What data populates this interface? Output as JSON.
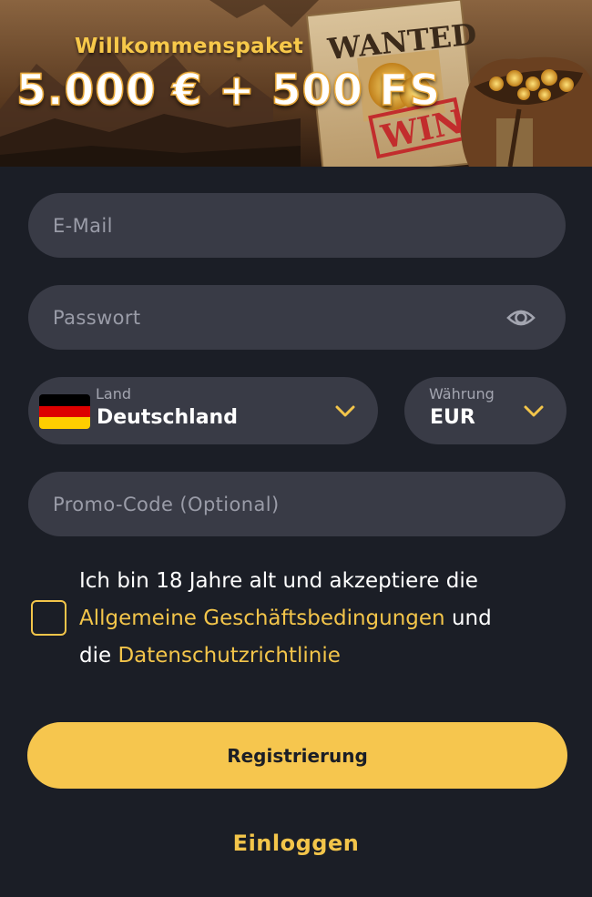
{
  "banner": {
    "subtitle": "Willkommenspaket",
    "title": "5.000 € + 500 FS",
    "poster_text": "WANTED",
    "stamp_text": "WIN"
  },
  "form": {
    "email_placeholder": "E-Mail",
    "password_placeholder": "Passwort",
    "country": {
      "label": "Land",
      "value": "Deutschland",
      "flag": "de-flag"
    },
    "currency": {
      "label": "Währung",
      "value": "EUR"
    },
    "promo_placeholder": "Promo-Code (Optional)",
    "consent": {
      "checked": false,
      "text_before": "Ich bin 18 Jahre alt und akzeptiere die",
      "terms_link": "Allgemeine Geschäftsbedingungen",
      "text_and": "und",
      "text_die": "die",
      "privacy_link": "Datenschutzrichtlinie"
    },
    "register_label": "Registrierung",
    "login_label": "Einloggen"
  },
  "colors": {
    "background": "#1b1e26",
    "field": "#393b46",
    "accent": "#f6c64e"
  }
}
